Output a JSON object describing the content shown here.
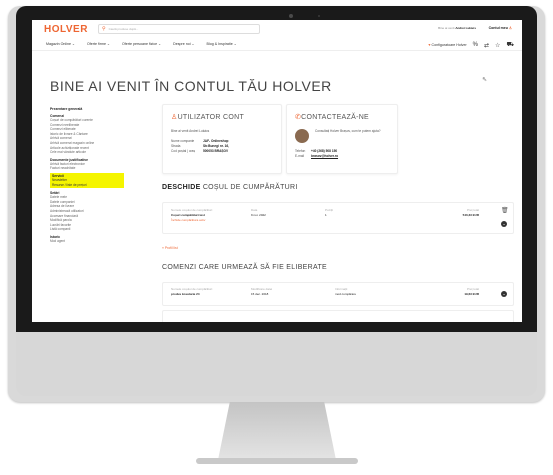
{
  "header": {
    "logo": "HOLVER",
    "search_placeholder": "Caută produse după...",
    "account_text": "Bine ai venit",
    "account_name": "Andrei Lukács",
    "contact_label": "Contul meu"
  },
  "nav": {
    "items": [
      "Magazin Online ⌄",
      "Oferte firme ⌄",
      "Oferte persoane fizice ⌄",
      "Despre noi ⌄",
      "Blog & Inspiratie ⌄"
    ],
    "configurator": "Configuratoare Holver"
  },
  "page": {
    "title": "BINE AI VENIT ÎN CONTUL TĂU HOLVER"
  },
  "sidebar": {
    "sections": [
      {
        "heading": "Prezentare generală",
        "items": []
      },
      {
        "heading": "Comenzi",
        "items": [
          "Coșuri de cumpărături curente",
          "Comenzi neeliberate",
          "Comenzi eliberate",
          "Istoric de livrare & Cântare",
          "Arhivă comenzi",
          "Arhivă comenzi magazin online",
          "Articole achiziționate recent",
          "Cele mai vândute articole"
        ]
      },
      {
        "heading": "Documente justificative",
        "items": [
          "Arhivă facturi electronice",
          "Facturi neachitate"
        ]
      },
      {
        "heading": "Servicii",
        "highlight": true,
        "items": [
          "Newsletter",
          "Resurse / liste de prețuri"
        ]
      },
      {
        "heading": "Setări",
        "items": [
          "Datele mele",
          "Datele companiei",
          "Adresa de livrare",
          "Administrează utilizatori",
          "Accesare financiară",
          "Modifică parola",
          "Lucrări favorite",
          "Listă companii"
        ]
      },
      {
        "heading": "Istoric",
        "items": [
          "Mod agent"
        ]
      }
    ]
  },
  "user_card": {
    "title": "UTILIZATOR CONT",
    "welcome": "Bine ai venit Andrei Lukács",
    "rows": [
      {
        "k": "Nume companie",
        "v": "JAF- Onlineshop"
      },
      {
        "k": "Strada",
        "v": "Str.Bunegi nr. 16,"
      },
      {
        "k": "Cod poștal | oraș",
        "v": "500053 BRAȘOV"
      }
    ]
  },
  "contact_card": {
    "title": "CONTACTEAZĂ-NE",
    "text": "Consultați Holver Brașov, cum te putem ajuta?",
    "phone_label": "Telefon",
    "phone": "+40 (268) 508 150",
    "email_label": "E-mail",
    "email": "brasov@holver.ro"
  },
  "cart": {
    "title_bold": "DESCHIDE",
    "title_rest": "COȘUL DE CUMPĂRĂTURI",
    "cols": [
      "Numele coșului de cumpărături",
      "Data",
      "Poziții",
      "Preț total"
    ],
    "name": "Coșuri cumpărături test",
    "link": "Închide cumpărătura activ",
    "date": "9 noi. 2022",
    "positions": "1",
    "price": "540,33 EUR",
    "back": "« Profil list"
  },
  "pending": {
    "title": "COMENZI CARE URMEAZĂ SĂ FIE ELIBERATE",
    "cols": [
      "Numele coșului de cumpărături",
      "Modificare datei",
      "Informații",
      "Preț total"
    ],
    "name": "produs kosutarie 24",
    "date": "15 dec. 2018",
    "info": "mod cumpărare",
    "price": "19,63 EUR"
  }
}
